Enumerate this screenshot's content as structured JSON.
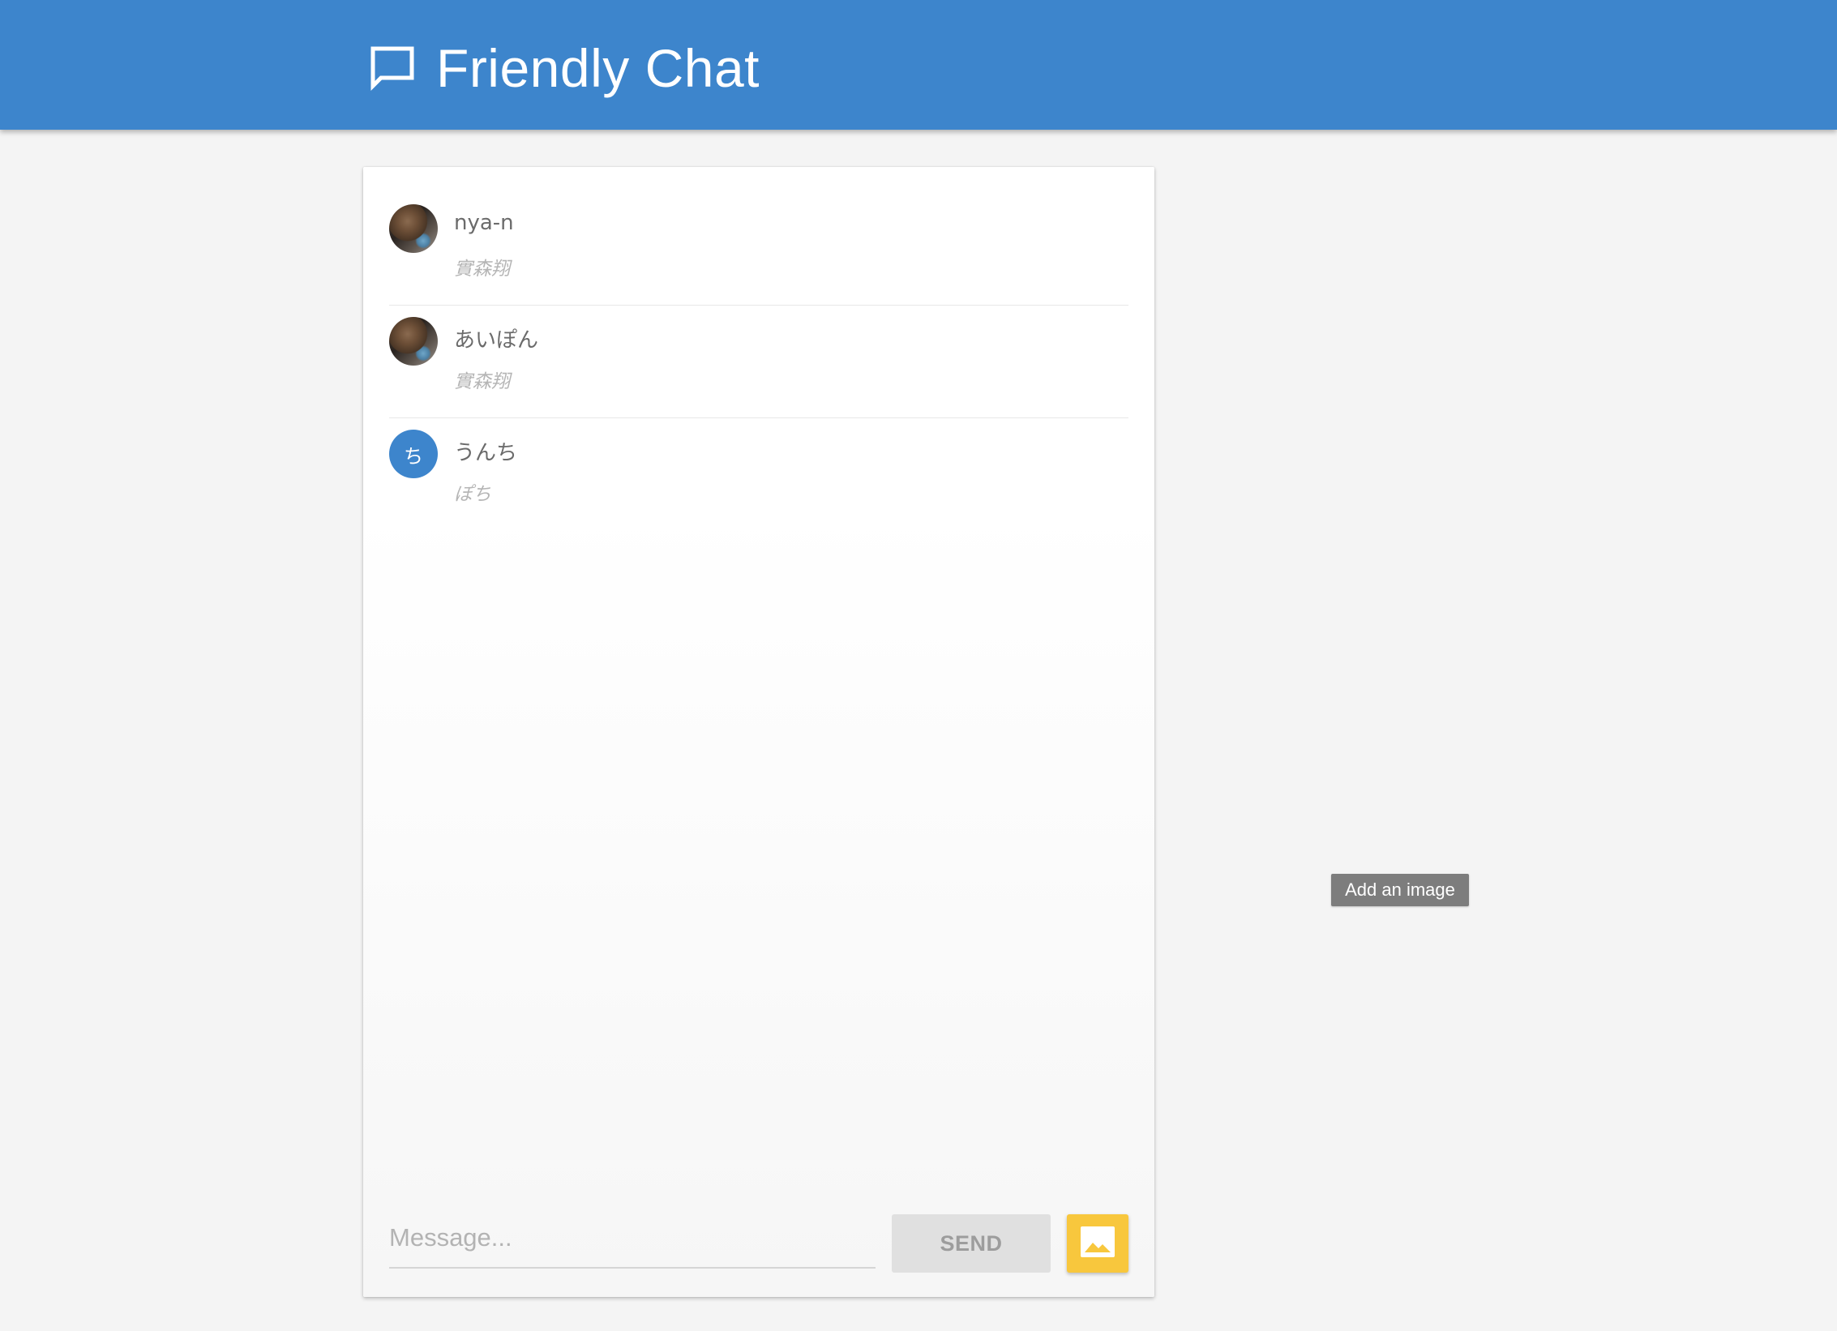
{
  "header": {
    "title": "Friendly Chat",
    "icon": "chat-bubble-icon",
    "color": "#3d85cc"
  },
  "messages": [
    {
      "name": "nya-n",
      "text": "實森翔",
      "avatar": "photo"
    },
    {
      "name": "あいぽん",
      "text": "實森翔",
      "avatar": "photo"
    },
    {
      "name": "うんち",
      "text": "ぽち",
      "avatar": "letter",
      "avatar_letter": "ち"
    }
  ],
  "composer": {
    "placeholder": "Message...",
    "send_label": "SEND",
    "image_button_icon": "image-icon",
    "image_button_color": "#f8c73d"
  },
  "tooltip": {
    "text": "Add an image"
  }
}
